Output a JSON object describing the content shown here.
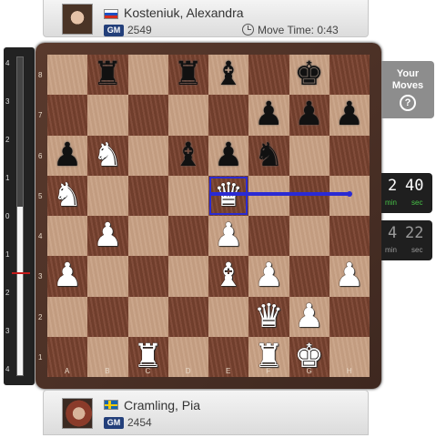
{
  "top_player": {
    "name": "Kosteniuk, Alexandra",
    "title": "GM",
    "rating": "2549",
    "country_flag": "flag-russia",
    "move_time_label": "Move Time: 0:43"
  },
  "bottom_player": {
    "name": "Cramling, Pia",
    "title": "GM",
    "rating": "2454",
    "country_flag": "flag-sweden"
  },
  "your_moves": {
    "label": "Your Moves",
    "icon": "?"
  },
  "clocks": {
    "top": {
      "minutes": "2",
      "seconds": "40",
      "min_label": "min",
      "sec_label": "sec"
    },
    "bottom": {
      "minutes": "4",
      "seconds": "22",
      "min_label": "min",
      "sec_label": "sec"
    }
  },
  "eval_bar": {
    "ticks": [
      "4",
      "3",
      "2",
      "1",
      "0",
      "1",
      "2",
      "3",
      "4"
    ],
    "white_share": 0.53
  },
  "board": {
    "files": [
      "A",
      "B",
      "C",
      "D",
      "E",
      "F",
      "G",
      "H"
    ],
    "ranks": [
      "8",
      "7",
      "6",
      "5",
      "4",
      "3",
      "2",
      "1"
    ],
    "pieces": [
      {
        "square": "b8",
        "color": "b",
        "type": "rook",
        "glyph": "♜"
      },
      {
        "square": "d8",
        "color": "b",
        "type": "rook",
        "glyph": "♜"
      },
      {
        "square": "e8",
        "color": "b",
        "type": "bishop",
        "glyph": "♝"
      },
      {
        "square": "g8",
        "color": "b",
        "type": "king",
        "glyph": "♚"
      },
      {
        "square": "f7",
        "color": "b",
        "type": "pawn",
        "glyph": "♟"
      },
      {
        "square": "g7",
        "color": "b",
        "type": "pawn",
        "glyph": "♟"
      },
      {
        "square": "h7",
        "color": "b",
        "type": "pawn",
        "glyph": "♟"
      },
      {
        "square": "a6",
        "color": "b",
        "type": "pawn",
        "glyph": "♟"
      },
      {
        "square": "b6",
        "color": "w",
        "type": "knight",
        "glyph": "♞"
      },
      {
        "square": "d6",
        "color": "b",
        "type": "bishop",
        "glyph": "♝"
      },
      {
        "square": "e6",
        "color": "b",
        "type": "pawn",
        "glyph": "♟"
      },
      {
        "square": "f6",
        "color": "b",
        "type": "knight",
        "glyph": "♞"
      },
      {
        "square": "a5",
        "color": "w",
        "type": "knight",
        "glyph": "♞"
      },
      {
        "square": "e5",
        "color": "w",
        "type": "queen",
        "glyph": "♛",
        "highlight": true
      },
      {
        "square": "b4",
        "color": "w",
        "type": "pawn",
        "glyph": "♟"
      },
      {
        "square": "e4",
        "color": "w",
        "type": "pawn",
        "glyph": "♟"
      },
      {
        "square": "a3",
        "color": "w",
        "type": "pawn",
        "glyph": "♟"
      },
      {
        "square": "e3",
        "color": "w",
        "type": "bishop",
        "glyph": "♝"
      },
      {
        "square": "f3",
        "color": "w",
        "type": "pawn",
        "glyph": "♟"
      },
      {
        "square": "h3",
        "color": "w",
        "type": "pawn",
        "glyph": "♟"
      },
      {
        "square": "f2",
        "color": "w",
        "type": "queen",
        "glyph": "♛"
      },
      {
        "square": "g2",
        "color": "w",
        "type": "pawn",
        "glyph": "♟"
      },
      {
        "square": "c1",
        "color": "w",
        "type": "rook",
        "glyph": "♜"
      },
      {
        "square": "f1",
        "color": "w",
        "type": "rook",
        "glyph": "♜"
      },
      {
        "square": "g1",
        "color": "w",
        "type": "king",
        "glyph": "♚"
      }
    ],
    "arrow": {
      "from": "e5",
      "to": "h5",
      "color": "#2a2ad4"
    }
  }
}
